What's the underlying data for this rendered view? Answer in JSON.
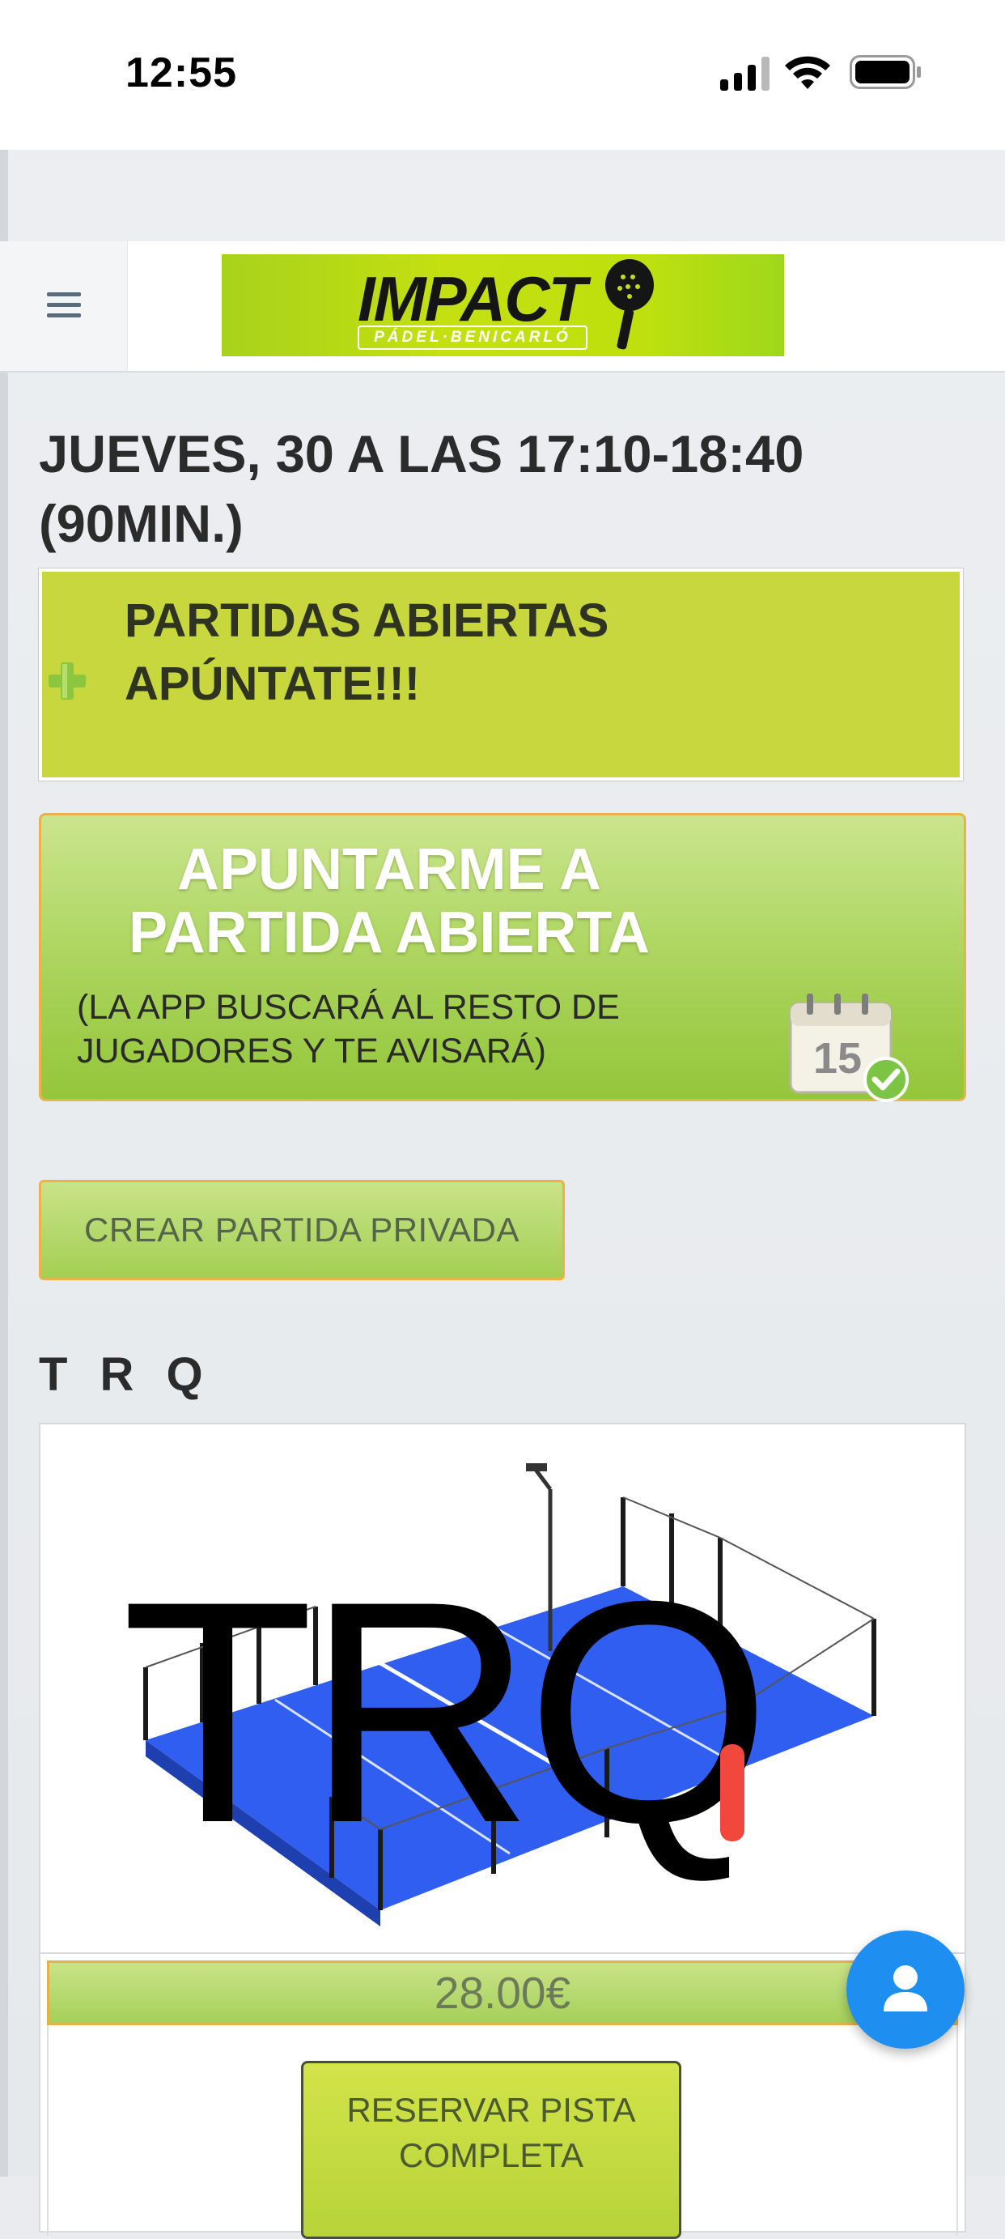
{
  "status_bar": {
    "time": "12:55"
  },
  "header": {
    "logo_word": "IMPACT",
    "logo_sub": "PÁDEL·BENICARLÓ"
  },
  "booking": {
    "date_title": "JUEVES, 30 A LAS 17:10-18:40 (90MIN.)",
    "open_matches_line1": "PARTIDAS ABIERTAS",
    "open_matches_line2": "APÚNTATE!!!",
    "join_title_line1": "APUNTARME A",
    "join_title_line2": "PARTIDA ABIERTA",
    "join_sub_line1": "(LA APP BUSCARÁ AL RESTO DE",
    "join_sub_line2": "JUGADORES Y TE AVISARÁ)",
    "calendar_day": "15",
    "create_private_label": "CREAR PARTIDA PRIVADA"
  },
  "club": {
    "name": "T R Q",
    "image_text": "TRQ",
    "price": "28.00€",
    "reserve_line1": "RESERVAR PISTA",
    "reserve_line2": "COMPLETA"
  },
  "icons": {
    "menu": "hamburger-menu-icon",
    "plus": "plus-icon",
    "calendar": "calendar-check-icon",
    "fab": "user-icon"
  },
  "colors": {
    "accent_green": "#c8d73d",
    "button_green": "#a9d35a",
    "button_border": "#e5b54a",
    "fab_blue": "#1e8ef0"
  }
}
